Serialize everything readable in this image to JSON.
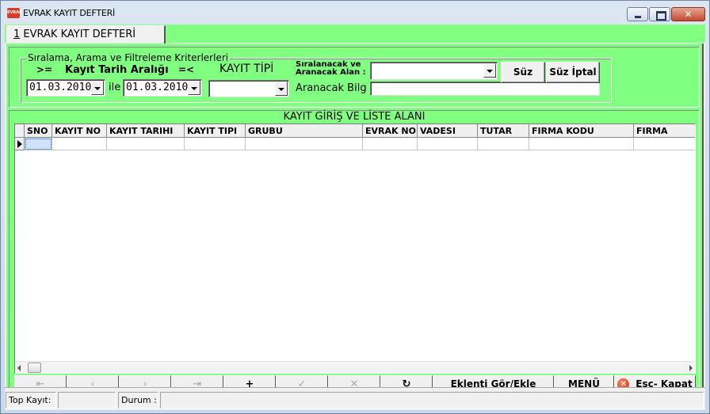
{
  "window": {
    "title": "EVRAK KAYIT DEFTERİ",
    "icon_text": "EVRAK"
  },
  "tab": {
    "number": "1",
    "label": " EVRAK KAYIT DEFTERİ"
  },
  "filters": {
    "group_title": "Sıralama, Arama ve Filtreleme Kriterlerleri",
    "gte_label": ">=",
    "date_range_label": "Kayıt Tarih Aralığı",
    "lte_label": "=<",
    "record_type_label": "KAYIT TİPİ",
    "start_date": "01.03.2010",
    "between_label": "ile",
    "end_date": "01.03.2010",
    "record_type_value": "",
    "sort_field_label_line1": "Sıralanacak ve",
    "sort_field_label_line2": "Aranacak Alan :",
    "sort_field_value": "",
    "search_label": "Aranacak Bilg",
    "search_value": "",
    "filter_button": "Süz",
    "filter_cancel_button": "Süz İptal"
  },
  "grid": {
    "title": "KAYIT GİRİŞ VE LİSTE ALANI",
    "columns": [
      "SNO",
      "KAYIT NO",
      "KAYIT TARIHI",
      "KAYIT TIPI",
      "GRUBU",
      "EVRAK NO",
      "VADESI",
      "TUTAR",
      "FIRMA KODU",
      "FIRMA"
    ]
  },
  "navigator": {
    "first": "⇤",
    "prior": "‹",
    "next": "›",
    "last": "⇥",
    "insert": "+",
    "post": "✓",
    "cancel": "✕",
    "refresh": "↻",
    "attachment_button": "Eklenti Gör/Ekle",
    "menu_button": "MENÜ",
    "close_button": "Esc- Kapat"
  },
  "status": {
    "total_label": "Top Kayıt:",
    "total_value": "",
    "state_label": "Durum :",
    "state_value": ""
  },
  "colors": {
    "form_bg": "#80ff80",
    "window_bg": "#f0f0f0"
  }
}
